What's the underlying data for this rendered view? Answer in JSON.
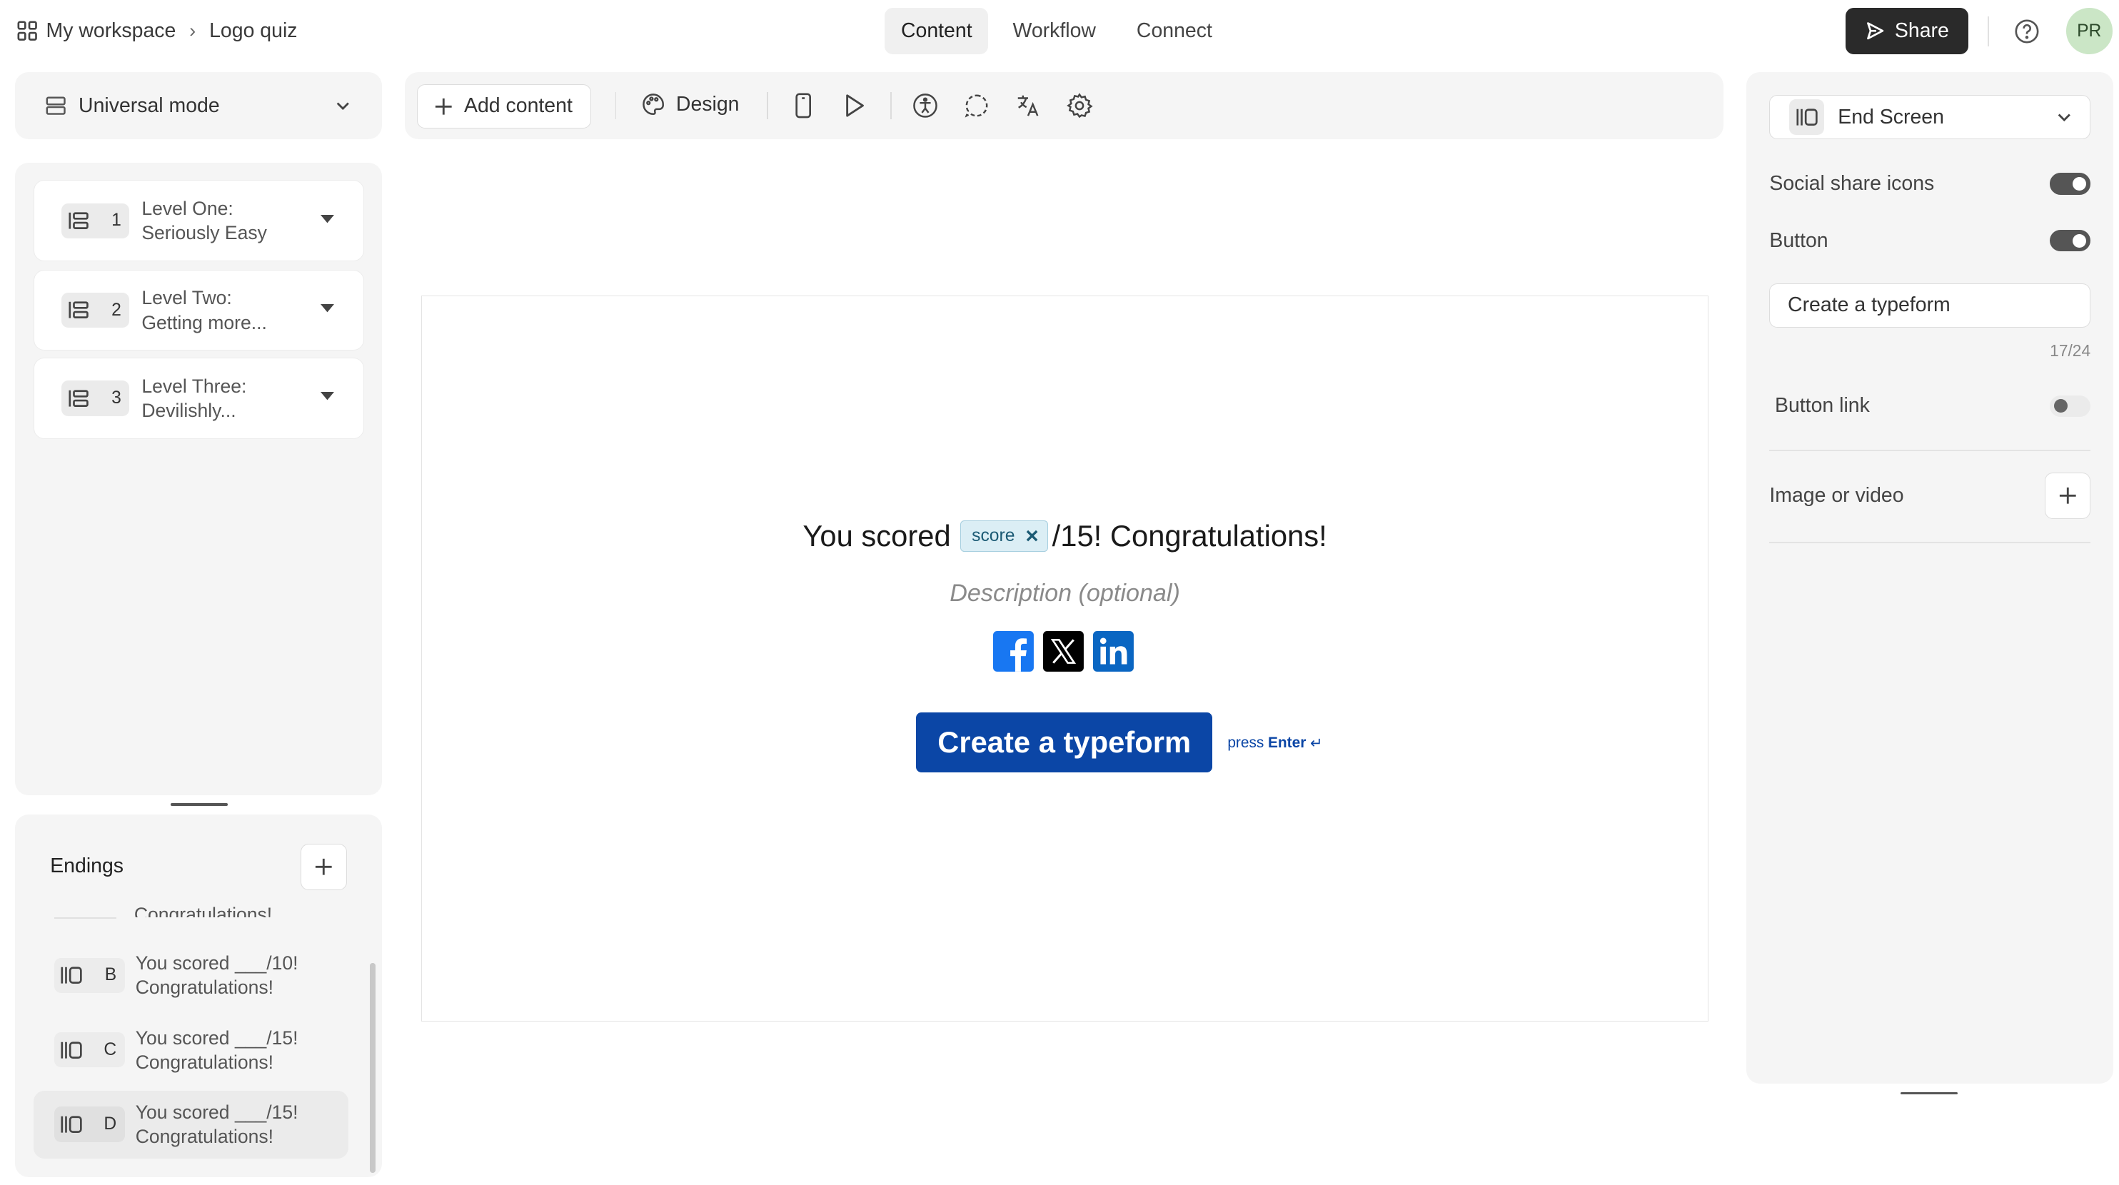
{
  "breadcrumb": {
    "workspace": "My workspace",
    "form": "Logo quiz"
  },
  "tabs": [
    {
      "label": "Content",
      "active": true
    },
    {
      "label": "Workflow",
      "active": false
    },
    {
      "label": "Connect",
      "active": false
    }
  ],
  "header": {
    "share_label": "Share",
    "avatar_initials": "PR"
  },
  "mode": {
    "label": "Universal mode"
  },
  "levels": [
    {
      "number": "1",
      "line1": "Level One:",
      "line2": "Seriously Easy"
    },
    {
      "number": "2",
      "line1": "Level Two:",
      "line2": "Getting more..."
    },
    {
      "number": "3",
      "line1": "Level Three:",
      "line2": "Devilishly..."
    }
  ],
  "endings": {
    "title": "Endings",
    "partial_item": "Congratulations!",
    "items": [
      {
        "letter": "B",
        "line1": "You scored ___/10!",
        "line2": "Congratulations!",
        "selected": false
      },
      {
        "letter": "C",
        "line1": "You scored ___/15!",
        "line2": "Congratulations!",
        "selected": false
      },
      {
        "letter": "D",
        "line1": "You scored ___/15!",
        "line2": "Congratulations!",
        "selected": true
      }
    ]
  },
  "toolbar": {
    "add_content_label": "Add content",
    "design_label": "Design"
  },
  "canvas": {
    "headline_before": "You scored",
    "score_chip": "score",
    "headline_after": "/15! Congratulations!",
    "description_placeholder": "Description (optional)",
    "cta_label": "Create a typeform",
    "press_label": "press",
    "enter_label": "Enter",
    "enter_glyph": "↵",
    "social_icons": [
      "facebook-icon",
      "x-twitter-icon",
      "linkedin-icon"
    ]
  },
  "settings": {
    "screen_type": "End Screen",
    "social_share_label": "Social share icons",
    "social_share_on": true,
    "button_label": "Button",
    "button_on": true,
    "button_text_value": "Create a typeform",
    "button_text_counter": "17/24",
    "button_link_label": "Button link",
    "button_link_on": false,
    "image_video_label": "Image or video"
  },
  "colors": {
    "cta_blue": "#0b46a6",
    "share_button": "#2a2a2a",
    "avatar_bg": "#cbe6c6",
    "chip_bg": "#dbeef5",
    "facebook": "#1877f2",
    "linkedin": "#0a66c2"
  }
}
